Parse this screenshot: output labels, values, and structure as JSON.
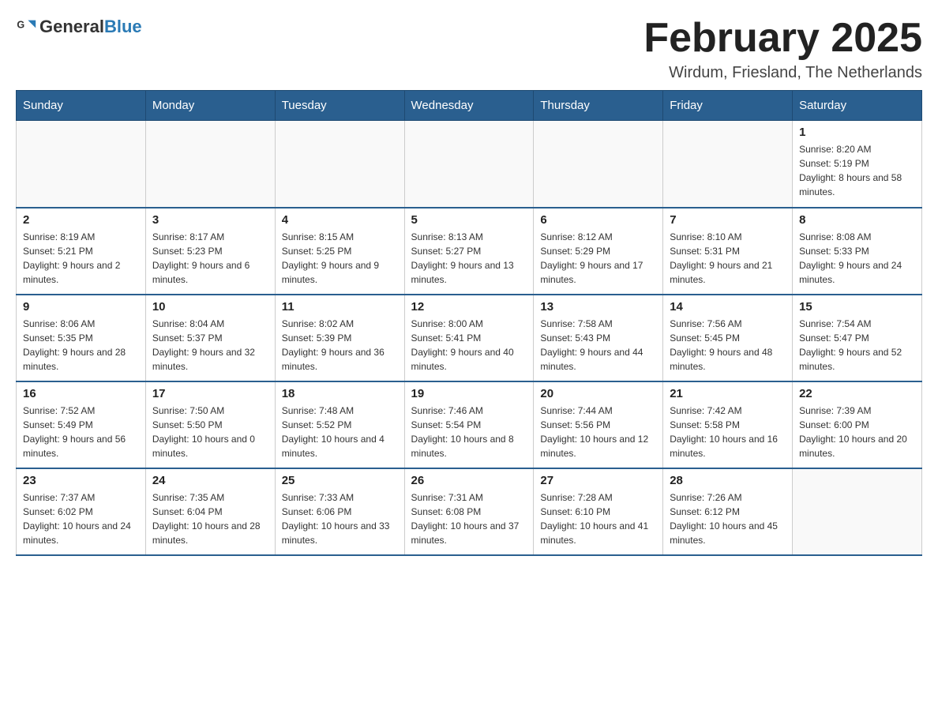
{
  "header": {
    "logo_general": "General",
    "logo_blue": "Blue",
    "month_title": "February 2025",
    "location": "Wirdum, Friesland, The Netherlands"
  },
  "weekdays": [
    "Sunday",
    "Monday",
    "Tuesday",
    "Wednesday",
    "Thursday",
    "Friday",
    "Saturday"
  ],
  "weeks": [
    [
      {
        "day": "",
        "info": ""
      },
      {
        "day": "",
        "info": ""
      },
      {
        "day": "",
        "info": ""
      },
      {
        "day": "",
        "info": ""
      },
      {
        "day": "",
        "info": ""
      },
      {
        "day": "",
        "info": ""
      },
      {
        "day": "1",
        "info": "Sunrise: 8:20 AM\nSunset: 5:19 PM\nDaylight: 8 hours and 58 minutes."
      }
    ],
    [
      {
        "day": "2",
        "info": "Sunrise: 8:19 AM\nSunset: 5:21 PM\nDaylight: 9 hours and 2 minutes."
      },
      {
        "day": "3",
        "info": "Sunrise: 8:17 AM\nSunset: 5:23 PM\nDaylight: 9 hours and 6 minutes."
      },
      {
        "day": "4",
        "info": "Sunrise: 8:15 AM\nSunset: 5:25 PM\nDaylight: 9 hours and 9 minutes."
      },
      {
        "day": "5",
        "info": "Sunrise: 8:13 AM\nSunset: 5:27 PM\nDaylight: 9 hours and 13 minutes."
      },
      {
        "day": "6",
        "info": "Sunrise: 8:12 AM\nSunset: 5:29 PM\nDaylight: 9 hours and 17 minutes."
      },
      {
        "day": "7",
        "info": "Sunrise: 8:10 AM\nSunset: 5:31 PM\nDaylight: 9 hours and 21 minutes."
      },
      {
        "day": "8",
        "info": "Sunrise: 8:08 AM\nSunset: 5:33 PM\nDaylight: 9 hours and 24 minutes."
      }
    ],
    [
      {
        "day": "9",
        "info": "Sunrise: 8:06 AM\nSunset: 5:35 PM\nDaylight: 9 hours and 28 minutes."
      },
      {
        "day": "10",
        "info": "Sunrise: 8:04 AM\nSunset: 5:37 PM\nDaylight: 9 hours and 32 minutes."
      },
      {
        "day": "11",
        "info": "Sunrise: 8:02 AM\nSunset: 5:39 PM\nDaylight: 9 hours and 36 minutes."
      },
      {
        "day": "12",
        "info": "Sunrise: 8:00 AM\nSunset: 5:41 PM\nDaylight: 9 hours and 40 minutes."
      },
      {
        "day": "13",
        "info": "Sunrise: 7:58 AM\nSunset: 5:43 PM\nDaylight: 9 hours and 44 minutes."
      },
      {
        "day": "14",
        "info": "Sunrise: 7:56 AM\nSunset: 5:45 PM\nDaylight: 9 hours and 48 minutes."
      },
      {
        "day": "15",
        "info": "Sunrise: 7:54 AM\nSunset: 5:47 PM\nDaylight: 9 hours and 52 minutes."
      }
    ],
    [
      {
        "day": "16",
        "info": "Sunrise: 7:52 AM\nSunset: 5:49 PM\nDaylight: 9 hours and 56 minutes."
      },
      {
        "day": "17",
        "info": "Sunrise: 7:50 AM\nSunset: 5:50 PM\nDaylight: 10 hours and 0 minutes."
      },
      {
        "day": "18",
        "info": "Sunrise: 7:48 AM\nSunset: 5:52 PM\nDaylight: 10 hours and 4 minutes."
      },
      {
        "day": "19",
        "info": "Sunrise: 7:46 AM\nSunset: 5:54 PM\nDaylight: 10 hours and 8 minutes."
      },
      {
        "day": "20",
        "info": "Sunrise: 7:44 AM\nSunset: 5:56 PM\nDaylight: 10 hours and 12 minutes."
      },
      {
        "day": "21",
        "info": "Sunrise: 7:42 AM\nSunset: 5:58 PM\nDaylight: 10 hours and 16 minutes."
      },
      {
        "day": "22",
        "info": "Sunrise: 7:39 AM\nSunset: 6:00 PM\nDaylight: 10 hours and 20 minutes."
      }
    ],
    [
      {
        "day": "23",
        "info": "Sunrise: 7:37 AM\nSunset: 6:02 PM\nDaylight: 10 hours and 24 minutes."
      },
      {
        "day": "24",
        "info": "Sunrise: 7:35 AM\nSunset: 6:04 PM\nDaylight: 10 hours and 28 minutes."
      },
      {
        "day": "25",
        "info": "Sunrise: 7:33 AM\nSunset: 6:06 PM\nDaylight: 10 hours and 33 minutes."
      },
      {
        "day": "26",
        "info": "Sunrise: 7:31 AM\nSunset: 6:08 PM\nDaylight: 10 hours and 37 minutes."
      },
      {
        "day": "27",
        "info": "Sunrise: 7:28 AM\nSunset: 6:10 PM\nDaylight: 10 hours and 41 minutes."
      },
      {
        "day": "28",
        "info": "Sunrise: 7:26 AM\nSunset: 6:12 PM\nDaylight: 10 hours and 45 minutes."
      },
      {
        "day": "",
        "info": ""
      }
    ]
  ]
}
